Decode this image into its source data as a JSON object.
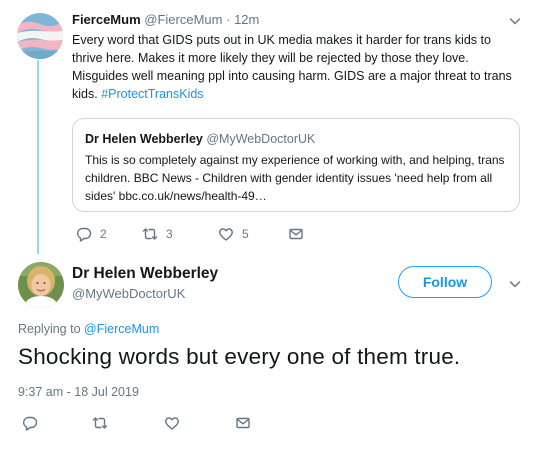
{
  "parent_tweet": {
    "display_name": "FierceMum",
    "handle": "@FierceMum",
    "separator": "·",
    "time": "12m",
    "text": "Every word that GIDS puts out in UK media makes it harder for trans kids to thrive here. Makes it more likely they will be rejected by those they love. Misguides well meaning ppl into causing harm. GIDS are a major threat to trans kids.",
    "hashtag": "#ProtectTransKids",
    "quoted": {
      "display_name": "Dr Helen Webberley",
      "handle": "@MyWebDoctorUK",
      "text": "This is so completely against my experience of working with, and helping, trans children. BBC News - Children with gender identity issues 'need help from all sides' bbc.co.uk/news/health-49…"
    },
    "actions": {
      "reply_count": "2",
      "retweet_count": "3",
      "like_count": "5"
    }
  },
  "focused_tweet": {
    "display_name": "Dr Helen Webberley",
    "handle": "@MyWebDoctorUK",
    "follow_label": "Follow",
    "replying_to_label": "Replying to",
    "replying_to_handle": "@FierceMum",
    "text": "Shocking words but every one of them true.",
    "timestamp": "9:37 am - 18 Jul 2019"
  },
  "colors": {
    "accent": "#1da1f2",
    "link": "#1b95e0",
    "muted": "#657786",
    "thread_line": "#9ad6f2",
    "border": "#ccd6dd"
  },
  "icons": [
    "reply-icon",
    "retweet-icon",
    "like-icon",
    "direct-message-icon",
    "chevron-down-icon"
  ]
}
